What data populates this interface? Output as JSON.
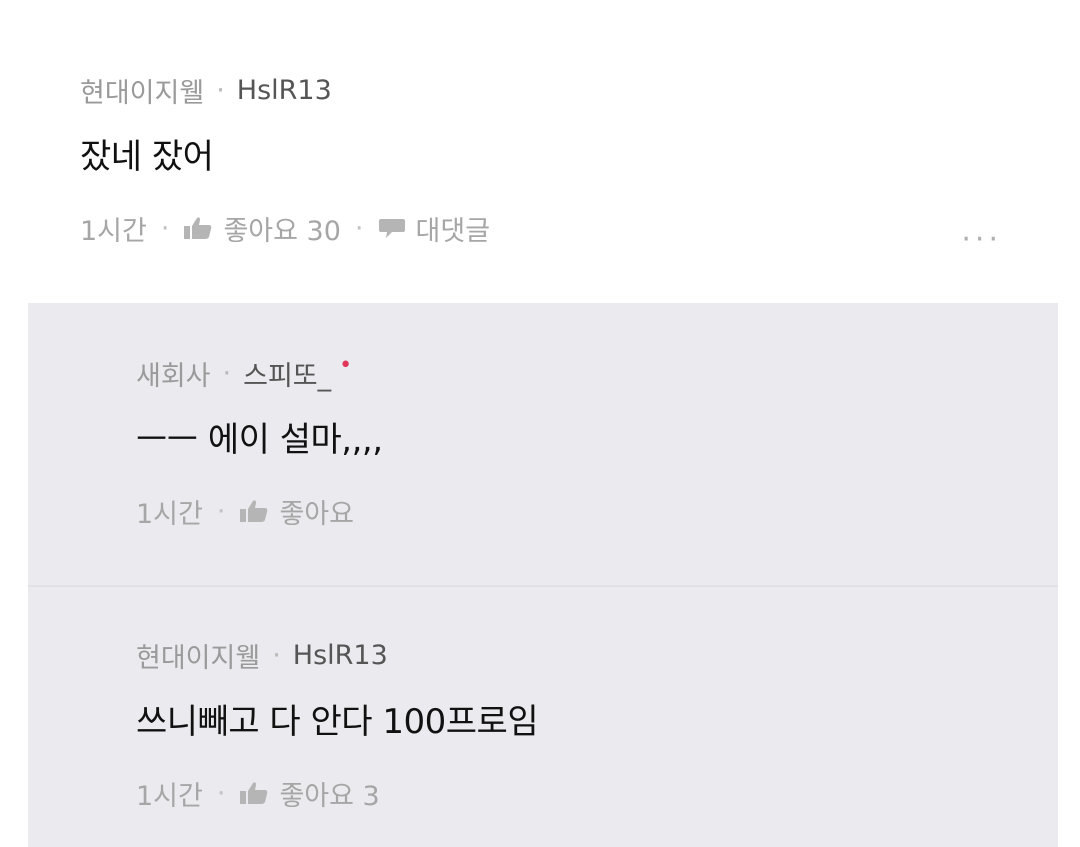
{
  "comment": {
    "company": "현대이지웰",
    "author": "HslR13",
    "text": "잤네 잤어",
    "time": "1시간",
    "like_label": "좋아요 30",
    "reply_label": "대댓글",
    "more_label": "···"
  },
  "replies": [
    {
      "company": "새회사",
      "author": "스피또_",
      "author_mark": "•",
      "text": "ㅡㅡ 에이 설마,,,,",
      "time": "1시간",
      "like_label": "좋아요"
    },
    {
      "company": "현대이지웰",
      "author": "HslR13",
      "text": "쓰니빼고 다 안다 100프로임",
      "time": "1시간",
      "like_label": "좋아요 3"
    }
  ],
  "icons": {
    "like": "thumbs-up-icon",
    "reply": "speech-bubble-icon",
    "more": "more-horizontal-icon"
  },
  "colors": {
    "reply_background": "#ebebef",
    "author_mark": "#e0365a",
    "meta_text": "#9a9a9a"
  }
}
